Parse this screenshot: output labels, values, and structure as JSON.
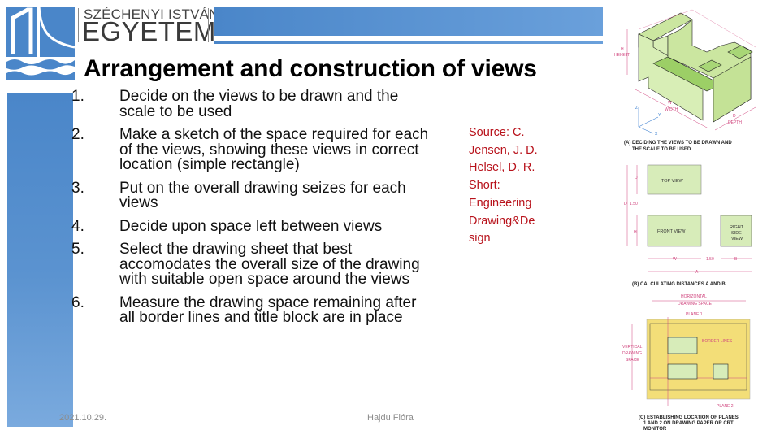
{
  "logo": {
    "line1": "SZÉCHENYI ISTVÁN",
    "line2": "EGYETEM",
    "brand_color": "#4a86c9"
  },
  "slide": {
    "title": "Arrangement and construction of views",
    "steps": [
      {
        "num": "1.",
        "text": "Decide on the views to be drawn and the scale to be used"
      },
      {
        "num": "2.",
        "text": "Make a sketch of the space required for each of the views, showing these views in correct location (simple rectangle)"
      },
      {
        "num": "3.",
        "text": "Put on the overall drawing seizes for each views"
      },
      {
        "num": "4.",
        "text": "Decide upon space left between views"
      },
      {
        "num": "5.",
        "text": "Select the drawing sheet that best accomodates the overall size of the drawing with suitable open space around the views"
      },
      {
        "num": "6.",
        "text": "Measure the drawing space remaining after all border lines and title block are in place"
      }
    ],
    "source_lines": [
      "Source: C.",
      "Jensen, J. D.",
      "Helsel, D. R.",
      "Short:",
      "Engineering",
      "Drawing&De",
      "sign"
    ],
    "source_color": "#b8121b"
  },
  "footer": {
    "date": "2021.10.29.",
    "author": "Hajdu Flóra"
  },
  "figure": {
    "a": {
      "height_label": "HEIGHT",
      "h": "H",
      "width_label": "WIDTH",
      "w": "W",
      "depth_label": "DEPTH",
      "d": "D",
      "axes": [
        "Z",
        "Y",
        "X"
      ],
      "caption_line1": "(A) DECIDING THE VIEWS TO BE DRAWN AND",
      "caption_line2": "THE SCALE TO BE USED"
    },
    "b": {
      "top_view": "TOP VIEW",
      "front_view": "FRONT VIEW",
      "right_side_view": [
        "RIGHT",
        "SIDE",
        "VIEW"
      ],
      "d": "D",
      "h": "H",
      "b": "B",
      "w": "W",
      "a": "A",
      "gap1": "1.50",
      "gap2": "1.50",
      "caption": "(B) CALCULATING DISTANCES A AND B"
    },
    "c": {
      "horizontal": [
        "HORIZONTAL",
        "DRAWING SPACE"
      ],
      "vertical": [
        "VERTICAL",
        "DRAWING",
        "SPACE"
      ],
      "plane1": "PLANE 1",
      "plane2": "PLANE 2",
      "border_lines": "BORDER LINES",
      "caption_line1": "(C) ESTABLISHING LOCATION OF PLANES",
      "caption_line2": "1 AND 2 ON DRAWING PAPER OR CRT",
      "caption_line3": "MONITOR"
    }
  }
}
